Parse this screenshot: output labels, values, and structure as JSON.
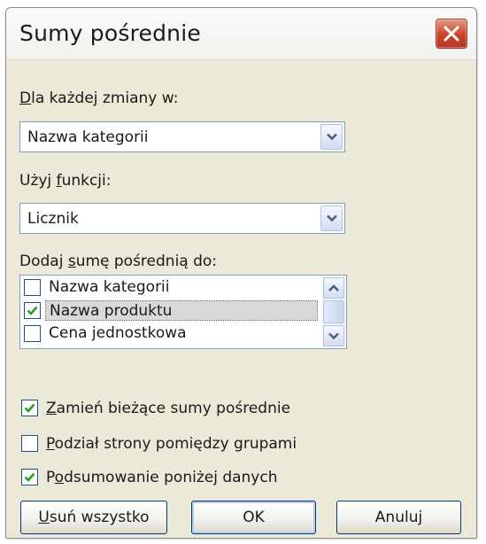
{
  "dialog": {
    "title": "Sumy pośrednie",
    "close_icon": "close-x-icon"
  },
  "group_by": {
    "label_accel": "D",
    "label_rest": "la każdej zmiany w:",
    "value": "Nazwa kategorii"
  },
  "function": {
    "label_pre": "Użyj ",
    "label_accel": "f",
    "label_rest": "unkcji:",
    "value": "Licznik"
  },
  "add_to": {
    "label_pre": "Dodaj ",
    "label_accel": "s",
    "label_rest": "umę pośrednią do:",
    "items": [
      {
        "label": "Nazwa kategorii",
        "checked": false,
        "selected": false
      },
      {
        "label": "Nazwa produktu",
        "checked": true,
        "selected": true
      },
      {
        "label": "Cena jednostkowa",
        "checked": false,
        "selected": false
      }
    ]
  },
  "options": {
    "replace": {
      "accel": "Z",
      "rest": "amień bieżące sumy pośrednie",
      "checked": true
    },
    "page_break": {
      "accel": "P",
      "rest": "odział strony pomiędzy grupami",
      "checked": false
    },
    "summary_below": {
      "pre": "P",
      "accel": "o",
      "rest": "dsumowanie poniżej danych",
      "checked": true
    }
  },
  "buttons": {
    "remove_all_accel": "U",
    "remove_all_rest": "suń wszystko",
    "ok": "OK",
    "cancel": "Anuluj"
  },
  "colors": {
    "dialog_bg": "#ece9d8",
    "check": "#21a121",
    "close": "#c9432a",
    "border": "#7f9db9"
  }
}
